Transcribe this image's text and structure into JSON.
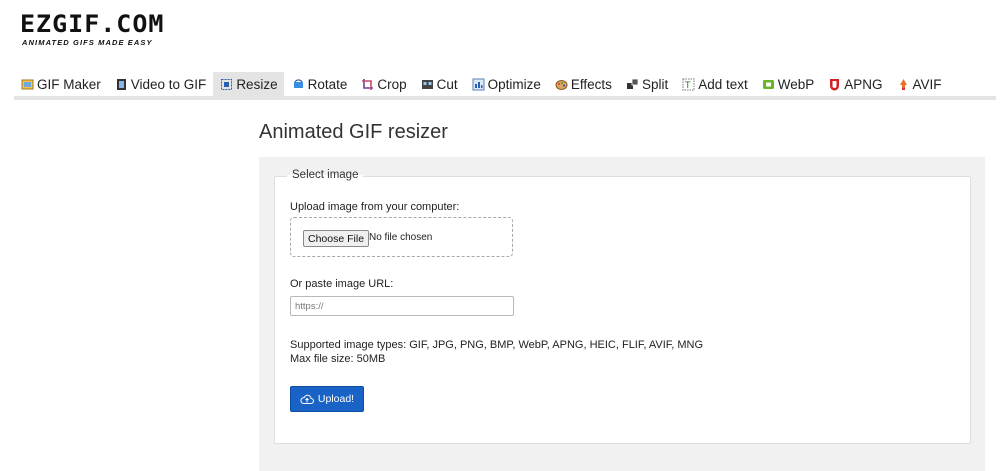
{
  "logo": {
    "name": "EZGIF.COM",
    "tagline": "ANIMATED GIFS MADE EASY"
  },
  "nav": {
    "items": [
      {
        "label": "GIF Maker",
        "icon": "gif-maker-icon",
        "active": false
      },
      {
        "label": "Video to GIF",
        "icon": "video-icon",
        "active": false
      },
      {
        "label": "Resize",
        "icon": "resize-icon",
        "active": true
      },
      {
        "label": "Rotate",
        "icon": "rotate-icon",
        "active": false
      },
      {
        "label": "Crop",
        "icon": "crop-icon",
        "active": false
      },
      {
        "label": "Cut",
        "icon": "cut-icon",
        "active": false
      },
      {
        "label": "Optimize",
        "icon": "optimize-icon",
        "active": false
      },
      {
        "label": "Effects",
        "icon": "effects-icon",
        "active": false
      },
      {
        "label": "Split",
        "icon": "split-icon",
        "active": false
      },
      {
        "label": "Add text",
        "icon": "add-text-icon",
        "active": false
      },
      {
        "label": "WebP",
        "icon": "webp-icon",
        "active": false
      },
      {
        "label": "APNG",
        "icon": "apng-icon",
        "active": false
      },
      {
        "label": "AVIF",
        "icon": "avif-icon",
        "active": false
      }
    ]
  },
  "main": {
    "title": "Animated GIF resizer",
    "form": {
      "legend": "Select image",
      "upload_label": "Upload image from your computer:",
      "choose_file_label": "Choose File",
      "no_file_text": "No file chosen",
      "url_label": "Or paste image URL:",
      "url_placeholder": "https://",
      "url_value": "",
      "supported_types": "Supported image types: GIF, JPG, PNG, BMP, WebP, APNG, HEIC, FLIF, AVIF, MNG",
      "max_size": "Max file size: 50MB",
      "upload_button": "Upload!"
    }
  },
  "colors": {
    "upload_button": "#1863c5",
    "nav_active_bg": "#e4e4e4",
    "panel_bg": "#f1f1f1"
  }
}
